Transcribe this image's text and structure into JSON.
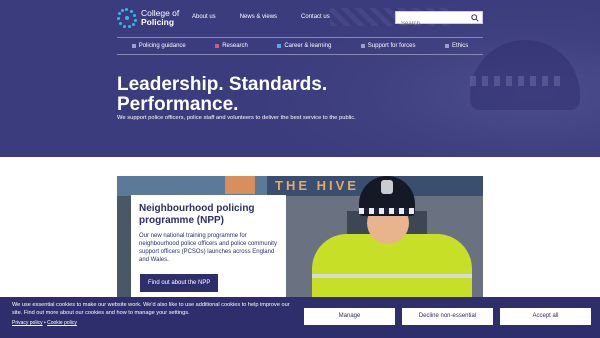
{
  "header": {
    "logo_line1": "College of",
    "logo_line2": "Policing",
    "top_links": [
      "About us",
      "News & views",
      "Contact us"
    ],
    "search_placeholder": "Search"
  },
  "main_nav": [
    {
      "label": "Policing guidance",
      "color": "#9aa0c9"
    },
    {
      "label": "Research",
      "color": "#e8527a"
    },
    {
      "label": "Career & learning",
      "color": "#39b7e8"
    },
    {
      "label": "Support for forces",
      "color": "#9aa0c9"
    },
    {
      "label": "Ethics",
      "color": "#9aa0c9"
    }
  ],
  "hero": {
    "title_line1": "Leadership. Standards.",
    "title_line2": "Performance.",
    "subtitle": "We support police officers, police staff and volunteers to deliver the best service to the public."
  },
  "feature": {
    "image_text": "THE HIVE",
    "card_title": "Neighbourhood policing programme (NPP)",
    "card_body": "Our new national training programme for neighbourhood police officers and police community support officers (PCSOs) launches across England and Wales.",
    "button_label": "Find out about the NPP"
  },
  "cookie": {
    "text": "We use essential cookies to make our website work. We'd also like to use additional cookies to help improve our site. Find out more about our cookies and how to manage your settings.",
    "privacy_link": "Privacy policy",
    "separator": "•",
    "cookie_link": "Cookie policy",
    "manage_label": "Manage",
    "decline_label": "Decline non-essential",
    "accept_label": "Accept all"
  },
  "colors": {
    "brand": "#2f2e6d",
    "hero_bg": "#3b3c7e",
    "accent_blue": "#39b7e8"
  }
}
